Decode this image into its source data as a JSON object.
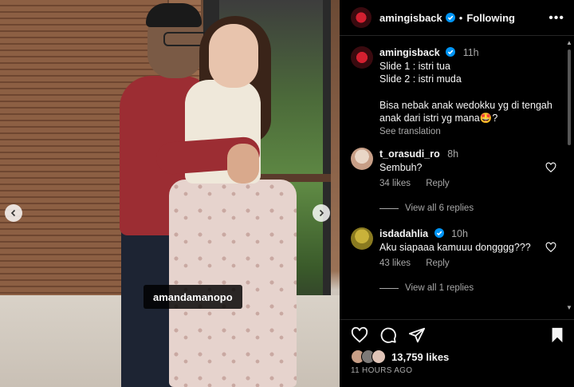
{
  "post": {
    "photo_tag": "amandamanopo"
  },
  "header": {
    "username": "amingisback",
    "separator": "•",
    "follow_label": "Following",
    "more_label": "•••"
  },
  "caption": {
    "username": "amingisback",
    "time": "11h",
    "line1": "Slide 1 : istri tua",
    "line2": "Slide 2 : istri muda",
    "line3": "Bisa nebak anak wedokku yg di tengah anak dari istri yg mana🤩?",
    "see_translation": "See translation"
  },
  "comments": [
    {
      "username": "t_orasudi_ro",
      "time": "8h",
      "text": "Sembuh?",
      "likes": "34 likes",
      "reply": "Reply",
      "view_replies": "View all 6 replies",
      "verified": false
    },
    {
      "username": "isdadahlia",
      "time": "10h",
      "text": "Aku siapaaa kamuuu dongggg???",
      "likes": "43 likes",
      "reply": "Reply",
      "view_replies": "View all 1 replies",
      "verified": true
    }
  ],
  "footer": {
    "like_count": "13,759 likes",
    "time_ago": "11 HOURS AGO"
  },
  "colors": {
    "background": "#000000",
    "text": "#f5f5f5",
    "muted": "#a8a8a8",
    "verified": "#0095f6"
  }
}
